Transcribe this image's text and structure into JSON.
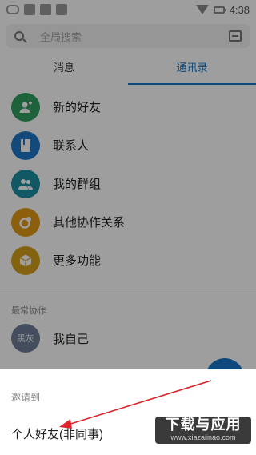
{
  "status": {
    "time": "4:38"
  },
  "search": {
    "placeholder": "全局搜索"
  },
  "tabs": [
    {
      "label": "消息",
      "active": false
    },
    {
      "label": "通讯录",
      "active": true
    }
  ],
  "contacts": [
    {
      "label": "新的好友",
      "icon": "add-friend-icon",
      "color": "#2f9e5f"
    },
    {
      "label": "联系人",
      "icon": "contact-book-icon",
      "color": "#1f78c8"
    },
    {
      "label": "我的群组",
      "icon": "group-icon",
      "color": "#1b8fa0"
    },
    {
      "label": "其他协作关系",
      "icon": "collaboration-icon",
      "color": "#e09a12"
    },
    {
      "label": "更多功能",
      "icon": "cube-icon",
      "color": "#d6a11a"
    }
  ],
  "frequent": {
    "title": "最常协作",
    "items": [
      {
        "avatar_text": "黑灰",
        "name": "我自己"
      }
    ]
  },
  "sheet": {
    "title": "邀请到",
    "option": "个人好友(非同事)"
  },
  "watermark": {
    "line1": "下载与应用",
    "line2": "www.xiazaiinao.com"
  },
  "colors": {
    "accent": "#1677c9",
    "arrow": "#d9262c"
  }
}
